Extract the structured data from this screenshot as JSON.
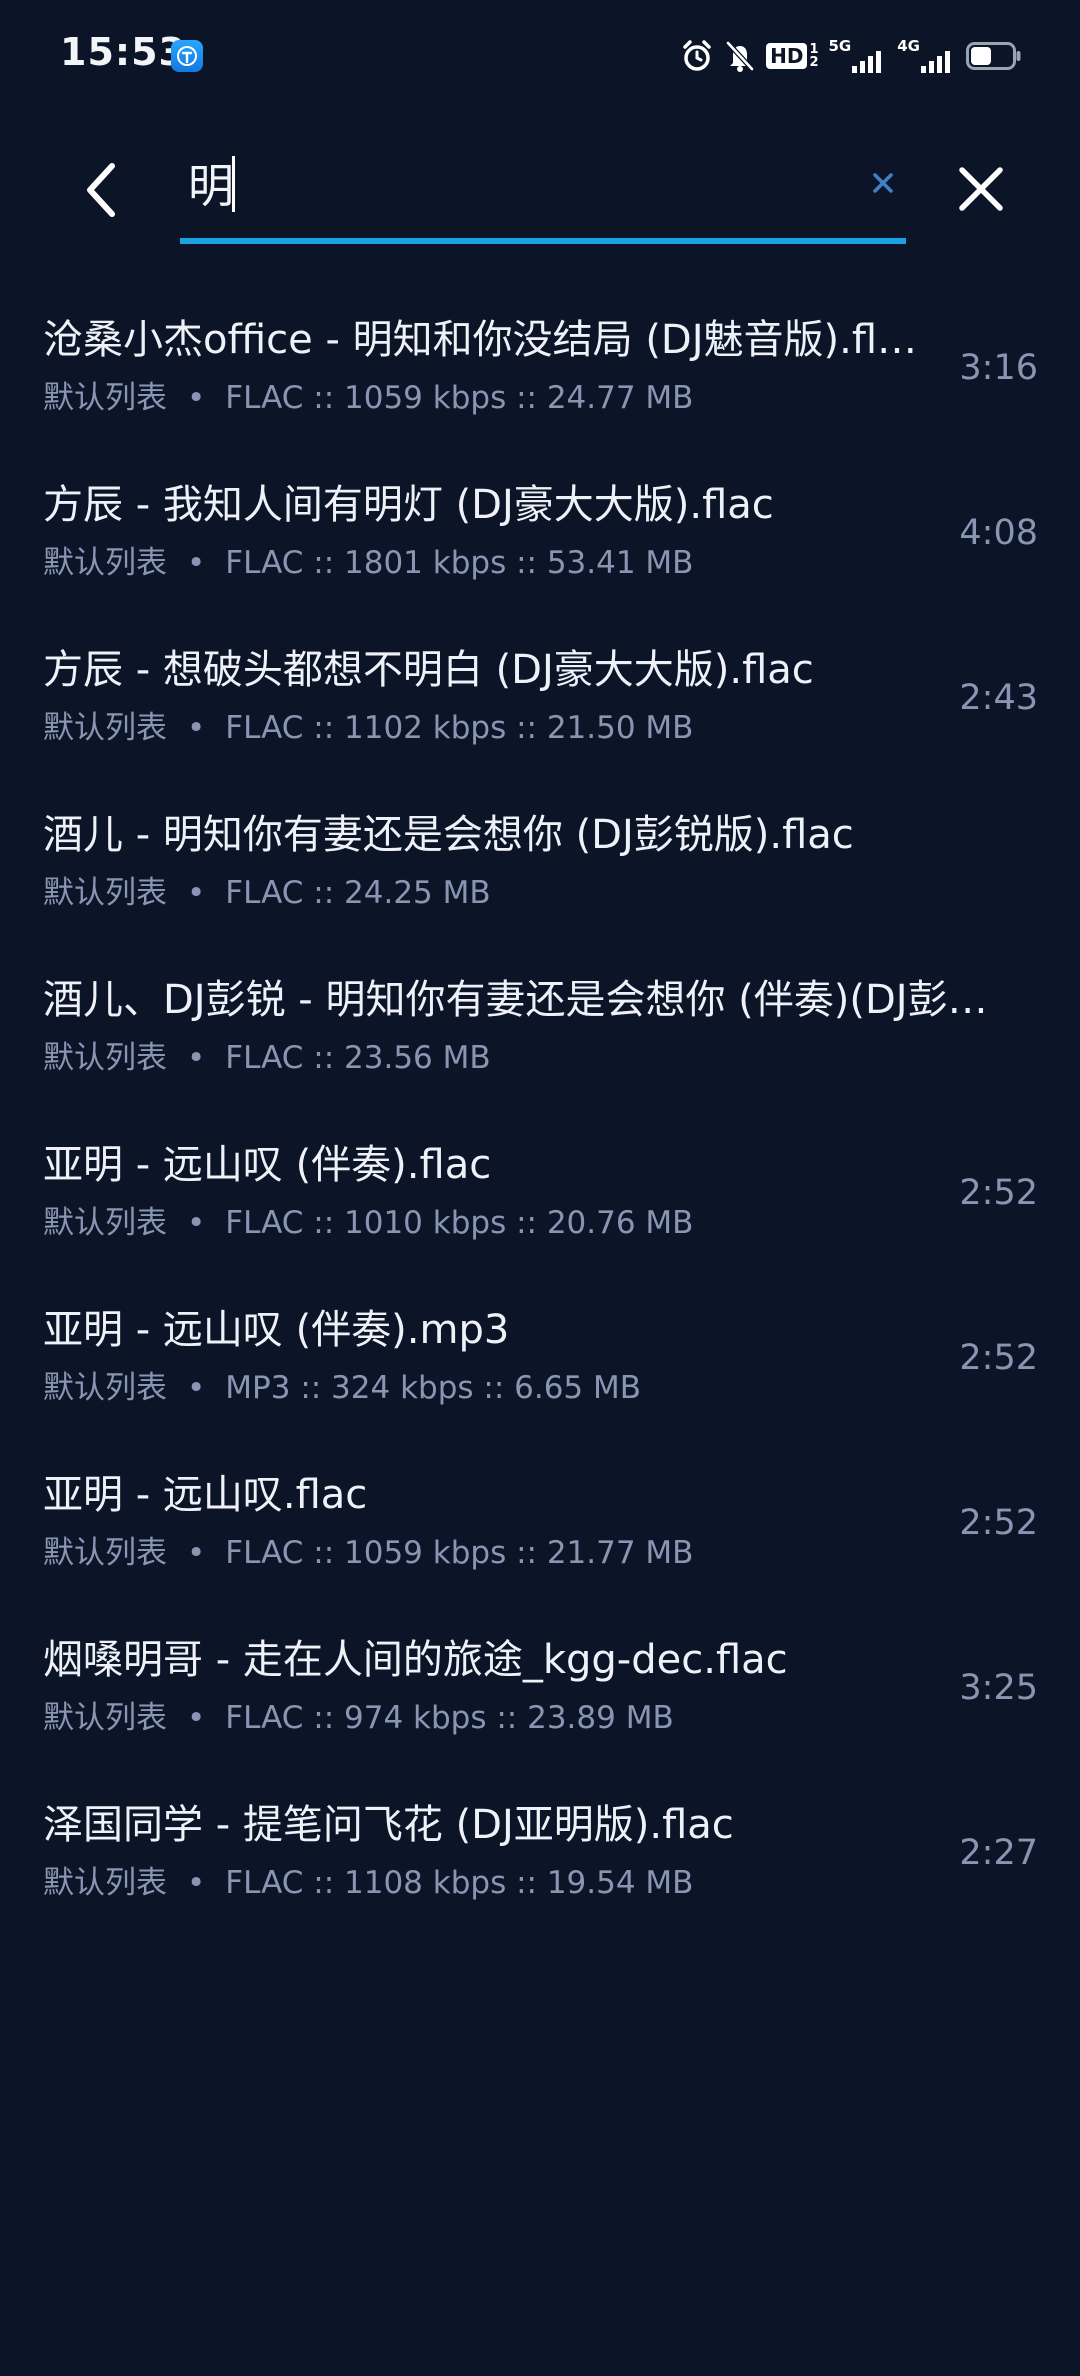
{
  "status_bar": {
    "time": "15:53",
    "app_icon": "app-notification-icon",
    "icons": [
      "alarm-icon",
      "silent-bell-icon",
      "hd-icon",
      "signal-5g-icon",
      "signal-4g-icon",
      "battery-icon"
    ],
    "hd_label": "HD",
    "hd_sub_1": "1",
    "hd_sub_2": "2",
    "net_5g": "5G",
    "net_4g": "4G"
  },
  "search": {
    "query": "明",
    "placeholder": "",
    "back_icon": "chevron-left-icon",
    "clear_icon": "clear-icon",
    "close_icon": "close-icon",
    "underline_color": "#1ba2e6"
  },
  "results": [
    {
      "title": "沧桑小杰office - 明知和你没结局 (DJ魅音版).flac",
      "playlist": "默认列表",
      "separator": "•",
      "details": "FLAC :: 1059 kbps :: 24.77 MB",
      "duration": "3:16"
    },
    {
      "title": "方辰 - 我知人间有明灯 (DJ豪大大版).flac",
      "playlist": "默认列表",
      "separator": "•",
      "details": "FLAC :: 1801 kbps :: 53.41 MB",
      "duration": "4:08"
    },
    {
      "title": "方辰 - 想破头都想不明白 (DJ豪大大版).flac",
      "playlist": "默认列表",
      "separator": "•",
      "details": "FLAC :: 1102 kbps :: 21.50 MB",
      "duration": "2:43"
    },
    {
      "title": "酒儿 - 明知你有妻还是会想你 (DJ彭锐版).flac",
      "playlist": "默认列表",
      "separator": "•",
      "details": "FLAC :: 24.25 MB",
      "duration": ""
    },
    {
      "title": "酒儿、DJ彭锐 - 明知你有妻还是会想你 (伴奏)(DJ彭…",
      "playlist": "默认列表",
      "separator": "•",
      "details": "FLAC :: 23.56 MB",
      "duration": ""
    },
    {
      "title": "亚明 - 远山叹 (伴奏).flac",
      "playlist": "默认列表",
      "separator": "•",
      "details": "FLAC :: 1010 kbps :: 20.76 MB",
      "duration": "2:52"
    },
    {
      "title": "亚明 - 远山叹 (伴奏).mp3",
      "playlist": "默认列表",
      "separator": "•",
      "details": "MP3 :: 324 kbps :: 6.65 MB",
      "duration": "2:52"
    },
    {
      "title": "亚明 - 远山叹.flac",
      "playlist": "默认列表",
      "separator": "•",
      "details": "FLAC :: 1059 kbps :: 21.77 MB",
      "duration": "2:52"
    },
    {
      "title": "烟嗓明哥 - 走在人间的旅途_kgg-dec.flac",
      "playlist": "默认列表",
      "separator": "•",
      "details": "FLAC :: 974 kbps :: 23.89 MB",
      "duration": "3:25"
    },
    {
      "title": "泽国同学 - 提笔问飞花 (DJ亚明版).flac",
      "playlist": "默认列表",
      "separator": "•",
      "details": "FLAC :: 1108 kbps :: 19.54 MB",
      "duration": "2:27"
    }
  ],
  "colors": {
    "background": "#0b1527",
    "title_text": "#eef1f7",
    "meta_text": "#8896b3",
    "accent": "#1ba2e6",
    "clear_icon": "#3f7fc4"
  }
}
